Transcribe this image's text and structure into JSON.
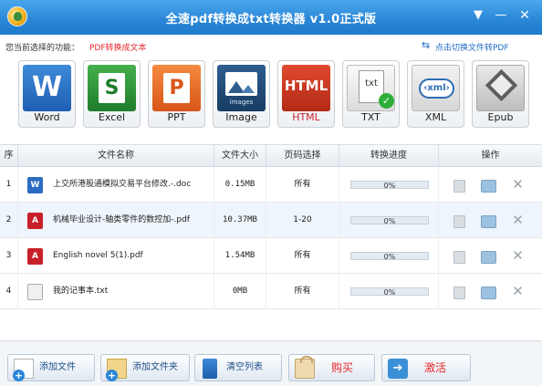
{
  "window": {
    "title": "全速pdf转换成txt转换器 v1.0正式版",
    "menu_glyph": "▼",
    "minimize_glyph": "—",
    "close_glyph": "✕"
  },
  "function_bar": {
    "label": "您当前选择的功能：",
    "value": "PDF转换成文本",
    "switch_link": "点击切换文件转PDF",
    "switch_icon": "⇆"
  },
  "formats": [
    {
      "label": "Word",
      "icon": "word-icon",
      "glyph": "W"
    },
    {
      "label": "Excel",
      "icon": "excel-icon",
      "glyph": "S"
    },
    {
      "label": "PPT",
      "icon": "ppt-icon",
      "glyph": "P"
    },
    {
      "label": "Image",
      "icon": "image-icon",
      "caption": "images"
    },
    {
      "label": "HTML",
      "icon": "html-icon",
      "glyph": "HTML"
    },
    {
      "label": "TXT",
      "icon": "txt-icon",
      "glyph": "txt",
      "check": "✓"
    },
    {
      "label": "XML",
      "icon": "xml-icon",
      "glyph": "‹xml›"
    },
    {
      "label": "Epub",
      "icon": "epub-icon"
    }
  ],
  "table": {
    "headers": [
      "序",
      "文件名称",
      "文件大小",
      "页码选择",
      "转换进度",
      "操作"
    ],
    "rows": [
      {
        "index": "1",
        "type_icon": "word-file-icon",
        "type_glyph": "W",
        "name": "上交所港股通模拟交易平台修改.-.doc",
        "size": "0.15MB",
        "pages": "所有",
        "progress_text": "0%",
        "progress": 0
      },
      {
        "index": "2",
        "type_icon": "pdf-file-icon",
        "type_glyph": "A",
        "name": "机械毕业设计-轴类零件的数控加-.pdf",
        "size": "10.37MB",
        "pages": "1-20",
        "progress_text": "0%",
        "progress": 0
      },
      {
        "index": "3",
        "type_icon": "pdf-file-icon",
        "type_glyph": "A",
        "name": "English novel 5(1).pdf",
        "size": "1.54MB",
        "pages": "所有",
        "progress_text": "0%",
        "progress": 0
      },
      {
        "index": "4",
        "type_icon": "txt-file-icon",
        "type_glyph": "",
        "name": "我的记事本.txt",
        "size": "0MB",
        "pages": "所有",
        "progress_text": "0%",
        "progress": 0
      }
    ],
    "delete_glyph": "✕"
  },
  "buttons": {
    "add_file": "添加文件",
    "add_folder": "添加文件夹",
    "clear_list": "清空列表",
    "buy": "购买",
    "activate": "激活"
  },
  "colors": {
    "title_bar": "#2a86d6",
    "accent_red": "#e8262a",
    "link_blue": "#1c6bc7",
    "progress_blue": "#4a9bde"
  }
}
